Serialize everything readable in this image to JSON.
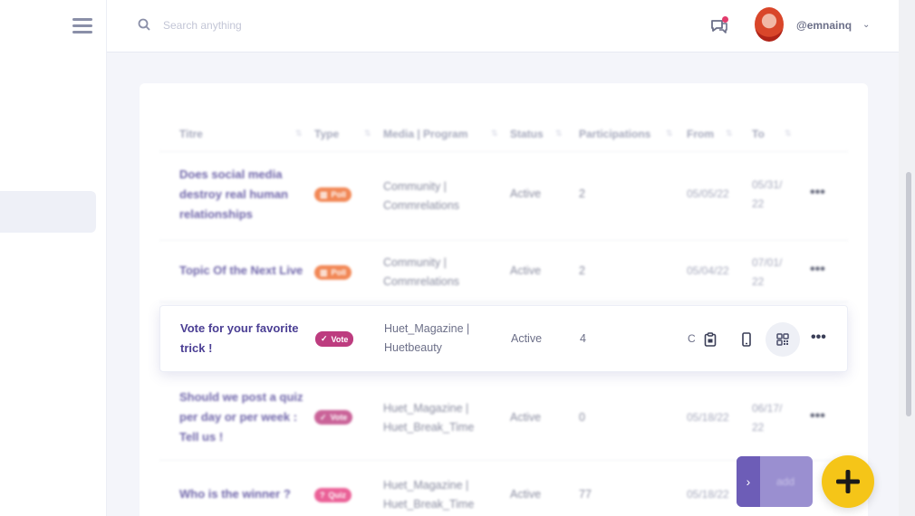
{
  "header": {
    "search_placeholder": "Search anything",
    "username": "@emnainq",
    "caret": "⌄"
  },
  "table": {
    "columns": [
      {
        "label": "Titre"
      },
      {
        "label": "Type"
      },
      {
        "label": "Media | Program"
      },
      {
        "label": "Status"
      },
      {
        "label": "Participations"
      },
      {
        "label": "From"
      },
      {
        "label": "To"
      }
    ],
    "rows": [
      {
        "title_lines": [
          "Does social media",
          "destroy real human",
          "relationships"
        ],
        "type": "Poll",
        "media_lines": [
          "Community |",
          "Commrelations"
        ],
        "status": "Active",
        "participations": "2",
        "from": "05/05/22",
        "to_lines": [
          "05/31/",
          "22"
        ]
      },
      {
        "title_lines": [
          "Topic Of the Next Live"
        ],
        "type": "Poll",
        "media_lines": [
          "Community |",
          "Commrelations"
        ],
        "status": "Active",
        "participations": "2",
        "from": "05/04/22",
        "to_lines": [
          "07/01/",
          "22"
        ]
      },
      {
        "title_lines": [
          "Vote for your favorite",
          "trick !"
        ],
        "type": "Vote",
        "media_lines": [
          "Huet_Magazine |",
          "Huetbeauty"
        ],
        "status": "Active",
        "participations": "4",
        "from": "C",
        "to_lines": []
      },
      {
        "title_lines": [
          "Should we post a quiz",
          "per day or per week :",
          "Tell us !"
        ],
        "type": "Vote",
        "media_lines": [
          "Huet_Magazine |",
          "Huet_Break_Time"
        ],
        "status": "Active",
        "participations": "0",
        "from": "05/18/22",
        "to_lines": [
          "06/17/",
          "22"
        ]
      },
      {
        "title_lines": [
          "Who is the winner ?"
        ],
        "type": "Quiz",
        "media_lines": [
          "Huet_Magazine |",
          "Huet_Break_Time"
        ],
        "status": "Active",
        "participations": "77",
        "from": "05/18/22",
        "to_lines": []
      }
    ],
    "more": "•••"
  },
  "add_panel": {
    "arrow": "›",
    "label": "add"
  },
  "colors": {
    "poll": "#ef6a2c",
    "vote": "#bd3c7f",
    "quiz": "#e63a7e",
    "fab": "#f5c518",
    "title": "#4b3f94"
  }
}
